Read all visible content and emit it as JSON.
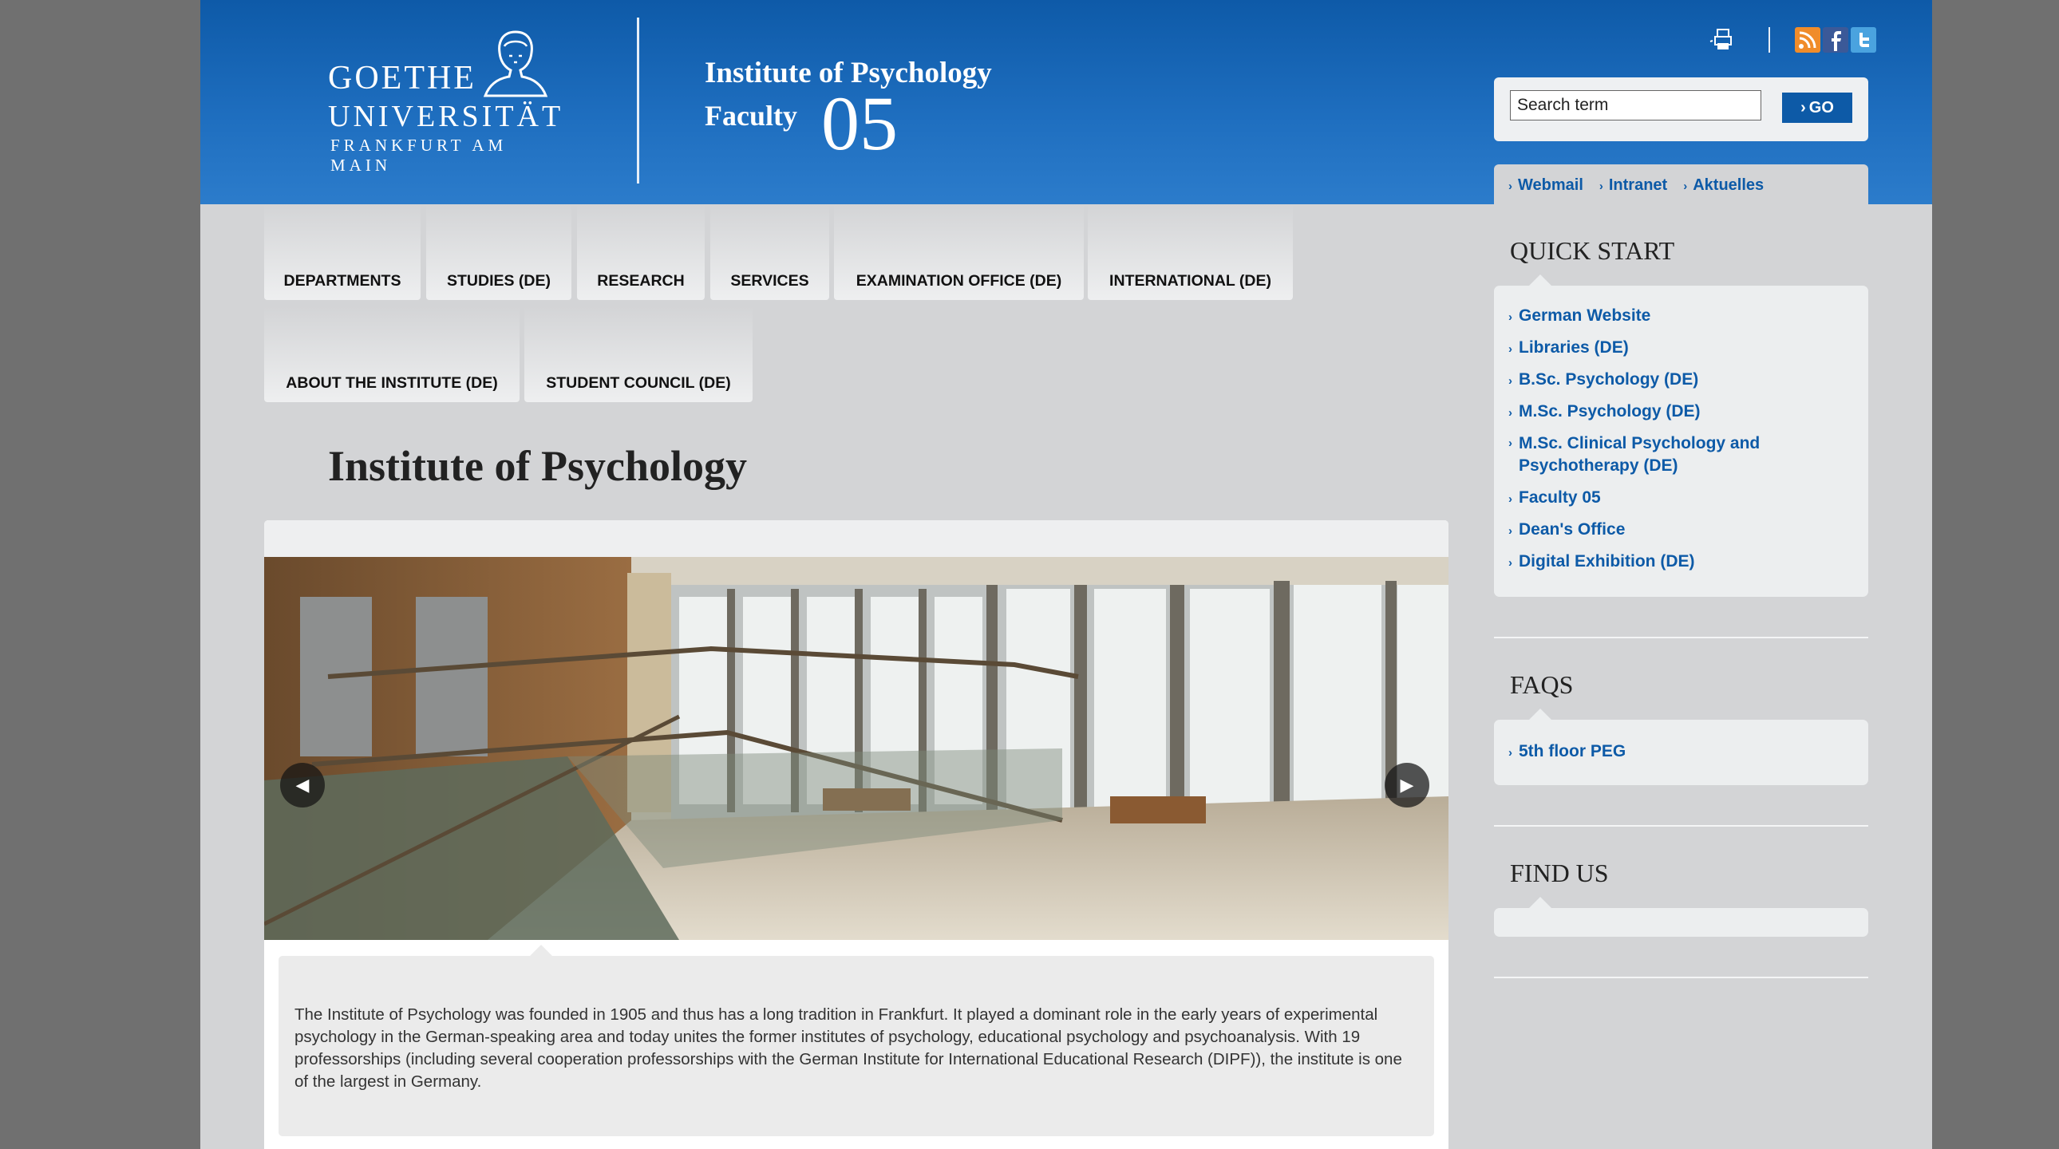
{
  "header": {
    "logo": {
      "line1": "GOETHE",
      "line2": "UNIVERSITÄT",
      "line3": "FRANKFURT AM MAIN"
    },
    "institute_title": "Institute of Psychology",
    "faculty_label": "Faculty",
    "faculty_number": "05",
    "utility_icons": [
      "print-icon",
      "rss-icon",
      "facebook-icon",
      "twitter-icon"
    ]
  },
  "search": {
    "placeholder": "Search term",
    "button_label": "GO"
  },
  "quick_links": [
    "Webmail",
    "Intranet",
    "Aktuelles"
  ],
  "nav": {
    "row1": [
      "DEPARTMENTS",
      "STUDIES (DE)",
      "RESEARCH",
      "SERVICES",
      "EXAMINATION OFFICE (DE)",
      "INTERNATIONAL (DE)"
    ],
    "row2": [
      "ABOUT THE INSTITUTE (DE)",
      "STUDENT COUNCIL (DE)"
    ]
  },
  "main": {
    "title": "Institute of Psychology",
    "caption": "The Institute of Psychology was founded in 1905 and thus has a long tradition in Frankfurt. It played a dominant role in the early years of experimental psychology in the German-speaking area and today unites the former institutes of psychology, educational psychology and psychoanalysis. With 19 professorships (including several cooperation professorships with the German Institute for International Educational Research (DIPF)), the institute is one of the largest in Germany."
  },
  "sidebar": {
    "quick_start": {
      "title": "QUICK START",
      "links": [
        "German Website",
        "Libraries (DE)",
        "B.Sc. Psychology (DE)",
        "M.Sc. Psychology (DE)",
        "M.Sc. Clinical Psychology and Psychotherapy (DE)",
        "Faculty 05",
        "Dean's Office",
        "Digital Exhibition (DE)"
      ]
    },
    "faqs": {
      "title": "FAQS",
      "links": [
        "5th floor PEG"
      ]
    },
    "find_us": {
      "title": "FIND US"
    }
  },
  "colors": {
    "brand_blue": "#0d5aa7",
    "header_top": "#0e5aa8",
    "page_bg": "#d3d4d6",
    "outer_bg": "#707070"
  }
}
